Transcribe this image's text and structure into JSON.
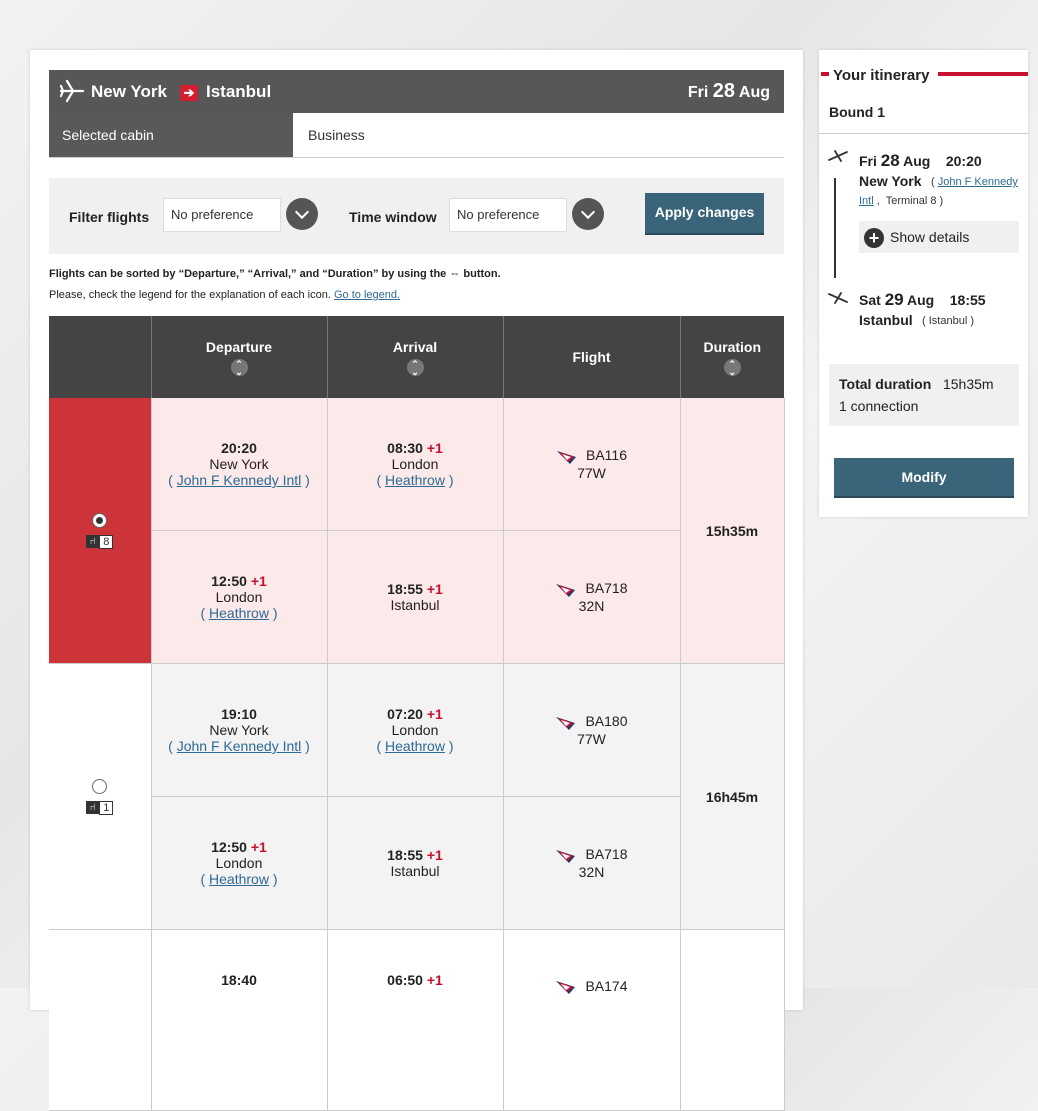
{
  "route": {
    "origin": "New York",
    "destination": "Istanbul",
    "date_day": "Fri",
    "date_num": "28",
    "date_month": "Aug",
    "arrow_glyph": "➔"
  },
  "cabin": {
    "label": "Selected cabin",
    "value": "Business"
  },
  "filters": {
    "filter_label": "Filter flights",
    "filter_value": "No preference",
    "time_label": "Time window",
    "time_value": "No preference",
    "apply_label": "Apply changes"
  },
  "notes": {
    "sort_note": "Flights can be sorted by “Departure,” “Arrival,” and “Duration” by using the ⇔ button.",
    "legend_prefix": "Please, check the legend for the explanation of each icon.",
    "legend_link": "Go to legend."
  },
  "table": {
    "headers": {
      "departure": "Departure",
      "arrival": "Arrival",
      "flight": "Flight",
      "duration": "Duration"
    },
    "options": [
      {
        "seats": "8",
        "duration": "15h35m",
        "segments": [
          {
            "dep_time": "20:20",
            "dep_plus": "",
            "dep_city": "New York",
            "dep_airport": "John F Kennedy Intl",
            "arr_time": "08:30",
            "arr_plus": "+1",
            "arr_city": "London",
            "arr_airport": "Heathrow",
            "flight": "BA116",
            "aircraft": "77W"
          },
          {
            "dep_time": "12:50",
            "dep_plus": "+1",
            "dep_city": "London",
            "dep_airport": "Heathrow",
            "arr_time": "18:55",
            "arr_plus": "+1",
            "arr_city": "Istanbul",
            "arr_airport": "",
            "flight": "BA718",
            "aircraft": "32N"
          }
        ]
      },
      {
        "seats": "1",
        "duration": "16h45m",
        "segments": [
          {
            "dep_time": "19:10",
            "dep_plus": "",
            "dep_city": "New York",
            "dep_airport": "John F Kennedy Intl",
            "arr_time": "07:20",
            "arr_plus": "+1",
            "arr_city": "London",
            "arr_airport": "Heathrow",
            "flight": "BA180",
            "aircraft": "77W"
          },
          {
            "dep_time": "12:50",
            "dep_plus": "+1",
            "dep_city": "London",
            "dep_airport": "Heathrow",
            "arr_time": "18:55",
            "arr_plus": "+1",
            "arr_city": "Istanbul",
            "arr_airport": "",
            "flight": "BA718",
            "aircraft": "32N"
          }
        ]
      },
      {
        "segments": [
          {
            "dep_time": "18:40",
            "arr_time": "06:50",
            "arr_plus": "+1",
            "flight": "BA174"
          }
        ]
      }
    ]
  },
  "itinerary": {
    "title": "Your itinerary",
    "bound": "Bound 1",
    "dep_day": "Fri",
    "dep_num": "28",
    "dep_month": "Aug",
    "dep_time": "20:20",
    "dep_city": "New York",
    "dep_airport_a": "John F Kennedy",
    "dep_airport_b": "Intl",
    "dep_terminal": "Terminal 8",
    "show_details": "Show details",
    "arr_day": "Sat",
    "arr_num": "29",
    "arr_month": "Aug",
    "arr_time": "18:55",
    "arr_city": "Istanbul",
    "arr_airport": "Istanbul",
    "total_label": "Total duration",
    "total_value": "15h35m",
    "connections": "1 connection",
    "modify_label": "Modify"
  },
  "colors": {
    "accent_red": "#c8102e",
    "button_blue": "#3a6479",
    "header_grey": "#444444"
  }
}
